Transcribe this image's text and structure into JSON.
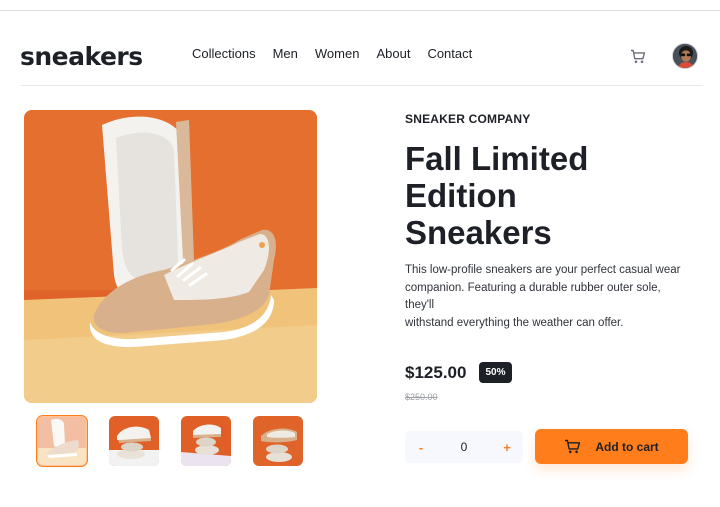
{
  "brand": {
    "logo": "sneakers"
  },
  "nav": {
    "items": [
      {
        "label": "Collections"
      },
      {
        "label": "Men"
      },
      {
        "label": "Women"
      },
      {
        "label": "About"
      },
      {
        "label": "Contact"
      }
    ]
  },
  "icons": {
    "cart": "cart-icon",
    "avatar": "avatar",
    "add_cart": "cart-icon"
  },
  "gallery": {
    "thumbnails": [
      {
        "name": "thumbnail-1",
        "active": true
      },
      {
        "name": "thumbnail-2",
        "active": false
      },
      {
        "name": "thumbnail-3",
        "active": false
      },
      {
        "name": "thumbnail-4",
        "active": false
      }
    ]
  },
  "product": {
    "company": "SNEAKER COMPANY",
    "title_lines": [
      "Fall Limited",
      "Edition",
      "Sneakers"
    ],
    "description_lines": [
      "This low-profile sneakers are your perfect casual wear",
      "companion. Featuring a durable rubber outer sole, they'll",
      "withstand everything the weather can offer."
    ],
    "price": "$125.00",
    "discount": "50%",
    "old_price": "$250.00"
  },
  "cart": {
    "minus": "-",
    "quantity": "0",
    "plus": "+",
    "add_label": "Add to cart"
  },
  "colors": {
    "accent": "#ff7e1b",
    "text": "#1d2026",
    "muted": "#9ea1a8",
    "qty_bg": "#f6f8fd"
  }
}
